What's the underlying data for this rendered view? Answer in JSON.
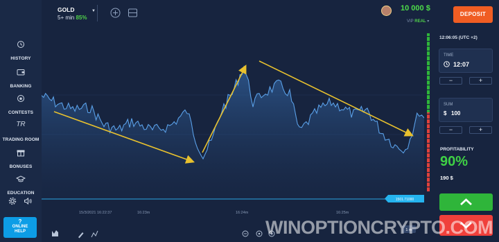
{
  "sidebar": {
    "items": [
      {
        "label": "HISTORY",
        "icon": "history-icon"
      },
      {
        "label": "BANKING",
        "icon": "wallet-icon"
      },
      {
        "label": "CONTESTS",
        "icon": "trophy-icon"
      },
      {
        "label": "TRADING ROOM",
        "icon": "tr-logo-icon",
        "glyph": "TR"
      },
      {
        "label": "BONUSES",
        "icon": "gift-icon"
      },
      {
        "label": "EDUCATION",
        "icon": "graduation-cap-icon"
      }
    ],
    "help": {
      "line1": "?",
      "line2": "ONLINE",
      "line3": "HELP"
    }
  },
  "asset": {
    "name": "GOLD",
    "expiry": "5+ min",
    "payout_pct": "85%"
  },
  "account": {
    "balance": "10 000 $",
    "vip": "VIP",
    "type": "REAL"
  },
  "deposit_label": "DEPOSIT",
  "chart_view": {
    "date_label": "15/3/2021 16:22:37",
    "time_labels": [
      "16:23m",
      "16:24m",
      "16:25m"
    ],
    "price_tag": "1501.71000",
    "timeframe": "1 m"
  },
  "trade": {
    "clock": "12:06:05 (UTC +2)",
    "time_caption": "TIME",
    "time_value": "12:07",
    "sum_caption": "SUM",
    "sum_value": "100",
    "currency": "$",
    "profit_caption": "PROFITABILITY",
    "profit_pct": "90%",
    "payout": "190 $",
    "minus": "−",
    "plus": "+"
  },
  "colors": {
    "background": "#17243f",
    "line": "#4a90d9",
    "arrows": "#e8c12e",
    "up": "#2fb53a",
    "down": "#f0403b",
    "deposit": "#f05d23",
    "profit": "#3fd145"
  },
  "watermark": "WINOPTIONCRYPTO.COM"
}
